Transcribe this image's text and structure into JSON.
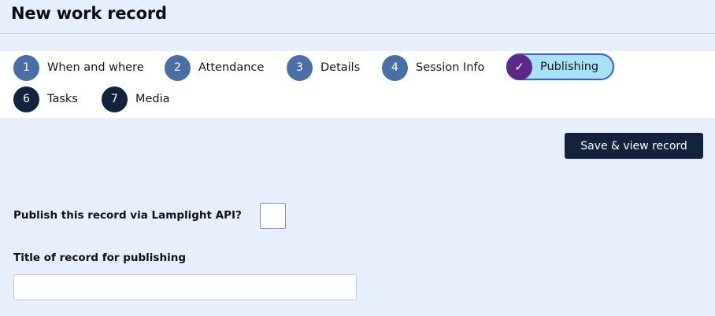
{
  "page": {
    "title": "New work record"
  },
  "steps": [
    {
      "number": "1",
      "label": "When and where",
      "state": "pending"
    },
    {
      "number": "2",
      "label": "Attendance",
      "state": "pending"
    },
    {
      "number": "3",
      "label": "Details",
      "state": "pending"
    },
    {
      "number": "4",
      "label": "Session Info",
      "state": "pending"
    },
    {
      "number": "✓",
      "label": "Publishing",
      "state": "active"
    },
    {
      "number": "6",
      "label": "Tasks",
      "state": "pending"
    },
    {
      "number": "7",
      "label": "Media",
      "state": "pending"
    }
  ],
  "actions": {
    "save_label": "Save & view record"
  },
  "form": {
    "publish_label": "Publish this record via Lamplight API?",
    "publish_checked": false,
    "title_label": "Title of record for publishing",
    "title_value": ""
  },
  "colors": {
    "background": "#e8effc",
    "step_blue": "#4a6fa5",
    "step_dark": "#11233d",
    "active_fill": "#a6e3f7",
    "active_check": "#5b2a86",
    "button": "#13233d"
  }
}
